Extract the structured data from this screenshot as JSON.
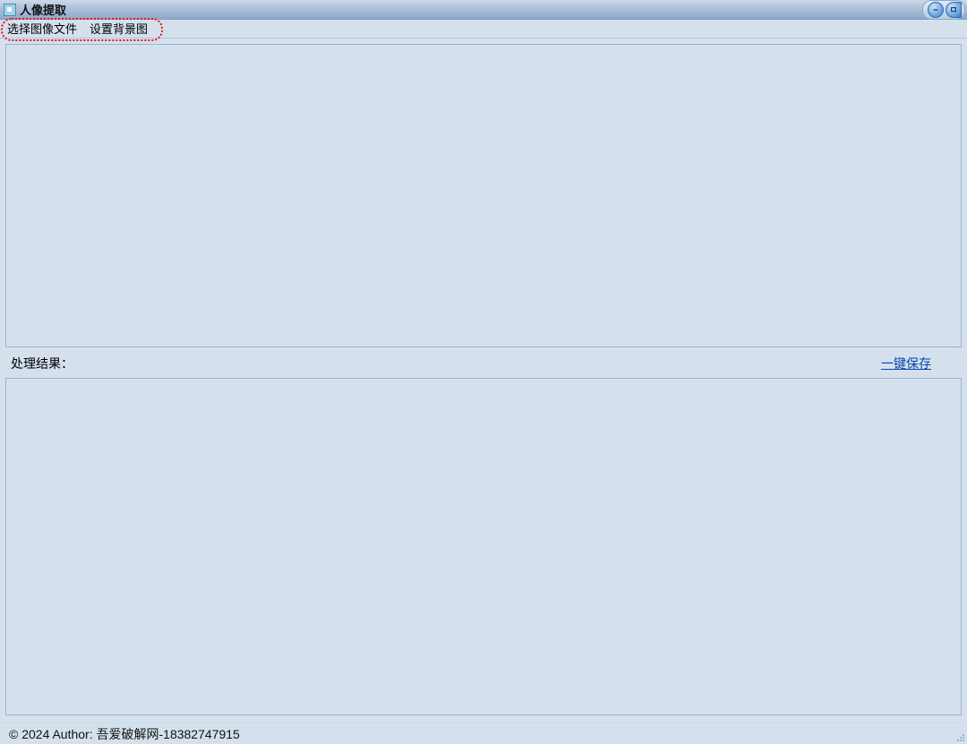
{
  "window": {
    "title": "人像提取"
  },
  "menubar": {
    "items": [
      "选择图像文件",
      "设置背景图"
    ]
  },
  "labels": {
    "result": "处理结果：",
    "save_link": "一键保存"
  },
  "statusbar": {
    "text": "© 2024 Author: 吾爱破解网-18382747915"
  }
}
